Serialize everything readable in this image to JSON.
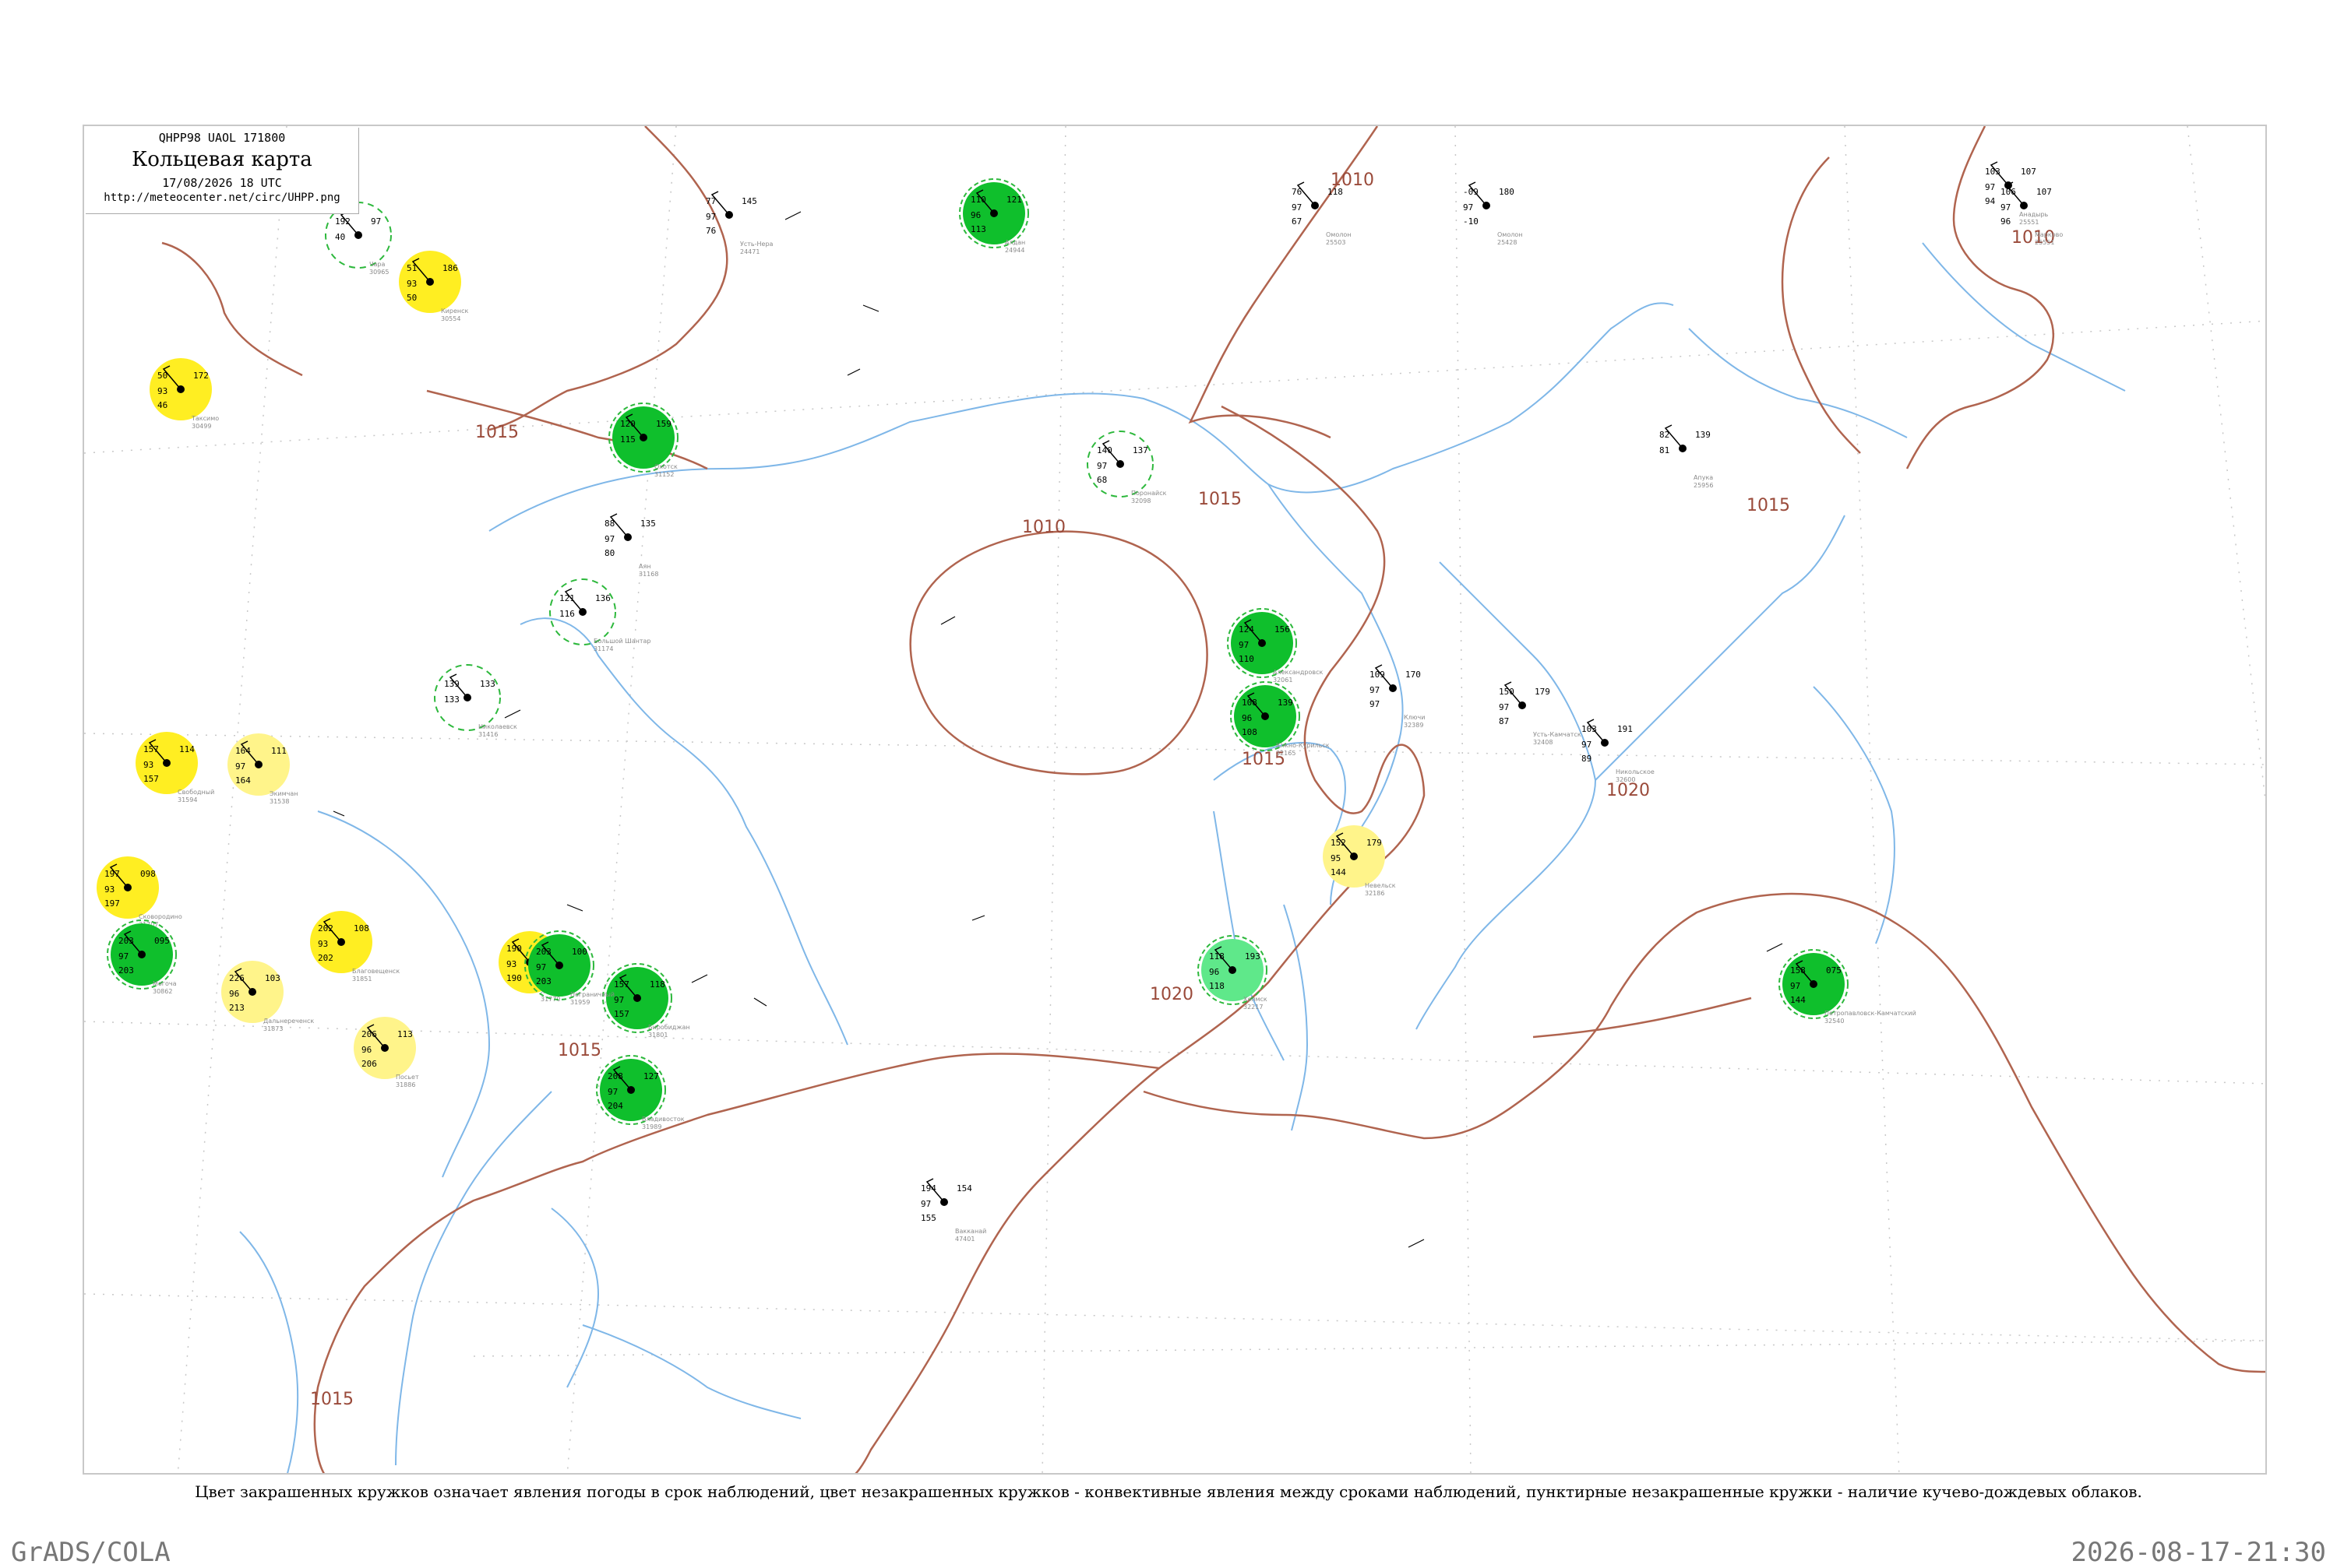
{
  "header": {
    "code": "QHPP98  UAOL  171800",
    "title": "Кольцевая карта",
    "datetime": "17/08/2026 18 UTC",
    "url": "http://meteocenter.net/circ/UHPP.png"
  },
  "caption": "Цвет закрашенных кружков означает явления погоды в срок наблюдений, цвет незакрашенных кружков - конвективные явления между сроками наблюдений, пунктирные незакрашенные кружки - наличие кучево-дождевых облаков.",
  "footer": {
    "left": "GrADS/COLA",
    "right": "2026-08-17-21:30"
  },
  "colors": {
    "isobar": "#b0644f",
    "river": "#7fb7e8",
    "green": "#0fbf2c",
    "light_green": "#5fe88a",
    "yellow": "#ffee22",
    "pale_yellow": "#fff48a",
    "dashed_ring": "#2db83c",
    "frame": "#c8c8c8"
  },
  "isobar_labels": [
    "1010",
    "1010",
    "1010",
    "1015",
    "1015",
    "1015",
    "1015",
    "1015",
    "1020",
    "1020",
    "1015"
  ],
  "stations": [
    {
      "id": "24471",
      "name": "Усть-Нера",
      "nums": [
        "77",
        "145",
        "97",
        "76"
      ],
      "marker": "none"
    },
    {
      "id": "24944",
      "name": "Алдан",
      "nums": [
        "110",
        "121",
        "96",
        "113"
      ],
      "marker": "green"
    },
    {
      "id": "25503",
      "name": "Омолон",
      "nums": [
        "76",
        "118",
        "97",
        "67"
      ],
      "marker": "none"
    },
    {
      "id": "25428",
      "name": "Омолон",
      "nums": [
        "-09",
        "180",
        "97",
        "-10"
      ],
      "marker": "none"
    },
    {
      "id": "25551",
      "name": "Марково",
      "nums": [
        "106",
        "107",
        "97",
        "96"
      ],
      "marker": "none"
    },
    {
      "id": "30554",
      "name": "Киренск",
      "nums": [
        "51",
        "186",
        "93",
        "50"
      ],
      "marker": "yellow"
    },
    {
      "id": "30499",
      "name": "Таксимо",
      "nums": [
        "50",
        "172",
        "93",
        "46"
      ],
      "marker": "yellow"
    },
    {
      "id": "30965",
      "name": "Чара",
      "nums": [
        "192",
        "97",
        "40"
      ],
      "marker": "dashed"
    },
    {
      "id": "31152",
      "name": "Охотск",
      "nums": [
        "120",
        "159",
        "115"
      ],
      "marker": "green"
    },
    {
      "id": "31168",
      "name": "Аян",
      "nums": [
        "88",
        "135",
        "97",
        "80"
      ],
      "marker": "none"
    },
    {
      "id": "31174",
      "name": "Большой Шантар",
      "nums": [
        "121",
        "136",
        "116"
      ],
      "marker": "dashed"
    },
    {
      "id": "31416",
      "name": "Николаевск",
      "nums": [
        "139",
        "133",
        "133"
      ],
      "marker": "dashed"
    },
    {
      "id": "32098",
      "name": "Поронайск",
      "nums": [
        "140",
        "137",
        "97",
        "68"
      ],
      "marker": "dashed"
    },
    {
      "id": "32061",
      "name": "Александровск",
      "nums": [
        "124",
        "156",
        "97",
        "110"
      ],
      "marker": "green"
    },
    {
      "id": "32165",
      "name": "Южно-Курильск",
      "nums": [
        "108",
        "139",
        "96",
        "108"
      ],
      "marker": "green"
    },
    {
      "id": "31707",
      "name": "Сковородино",
      "nums": [
        "197",
        "098",
        "93",
        "197"
      ],
      "marker": "yellow"
    },
    {
      "id": "30862",
      "name": "Могоча",
      "nums": [
        "203",
        "095",
        "97",
        "203"
      ],
      "marker": "green"
    },
    {
      "id": "31594",
      "name": "Свободный",
      "nums": [
        "157",
        "114",
        "93",
        "157"
      ],
      "marker": "yellow"
    },
    {
      "id": "31538",
      "name": "Экимчан",
      "nums": [
        "164",
        "111",
        "97",
        "164"
      ],
      "marker": "pale_yellow"
    },
    {
      "id": "31851",
      "name": "Благовещенск",
      "nums": [
        "202",
        "108",
        "93",
        "202"
      ],
      "marker": "yellow"
    },
    {
      "id": "31873",
      "name": "Дальнереченск",
      "nums": [
        "226",
        "103",
        "96",
        "213"
      ],
      "marker": "pale_yellow"
    },
    {
      "id": "31770",
      "name": "Хабаровск",
      "nums": [
        "190",
        "116",
        "93",
        "190"
      ],
      "marker": "yellow"
    },
    {
      "id": "31801",
      "name": "Биробиджан",
      "nums": [
        "157",
        "118",
        "97",
        "157"
      ],
      "marker": "green"
    },
    {
      "id": "32217",
      "name": "Холмск",
      "nums": [
        "118",
        "193",
        "96",
        "118"
      ],
      "marker": "light_green"
    },
    {
      "id": "32186",
      "name": "Невельск",
      "nums": [
        "152",
        "179",
        "95",
        "144"
      ],
      "marker": "pale_yellow"
    },
    {
      "id": "31886",
      "name": "Посьет",
      "nums": [
        "206",
        "113",
        "96",
        "206"
      ],
      "marker": "pale_yellow"
    },
    {
      "id": "31959",
      "name": "Пограничный",
      "nums": [
        "203",
        "100",
        "97",
        "203"
      ],
      "marker": "green"
    },
    {
      "id": "32540",
      "name": "Петропавловск-Камчатский",
      "nums": [
        "158",
        "075",
        "97",
        "144"
      ],
      "marker": "green"
    },
    {
      "id": "31989",
      "name": "Владивосток",
      "nums": [
        "208",
        "127",
        "97",
        "204"
      ],
      "marker": "green"
    },
    {
      "id": "47401",
      "name": "Вакканай",
      "nums": [
        "194",
        "154",
        "97",
        "155"
      ],
      "marker": "none"
    },
    {
      "id": "32389",
      "name": "Ключи",
      "nums": [
        "109",
        "170",
        "97",
        "97"
      ],
      "marker": "none"
    },
    {
      "id": "32408",
      "name": "Усть-Камчатск",
      "nums": [
        "150",
        "179",
        "97",
        "87"
      ],
      "marker": "none"
    },
    {
      "id": "32600",
      "name": "Никольское",
      "nums": [
        "103",
        "191",
        "97",
        "89"
      ],
      "marker": "none"
    },
    {
      "id": "25956",
      "name": "Апука",
      "nums": [
        "82",
        "139",
        "81"
      ],
      "marker": "none"
    },
    {
      "id": "25551",
      "name": "Анадырь",
      "nums": [
        "103",
        "107",
        "97",
        "94"
      ],
      "marker": "none"
    }
  ]
}
